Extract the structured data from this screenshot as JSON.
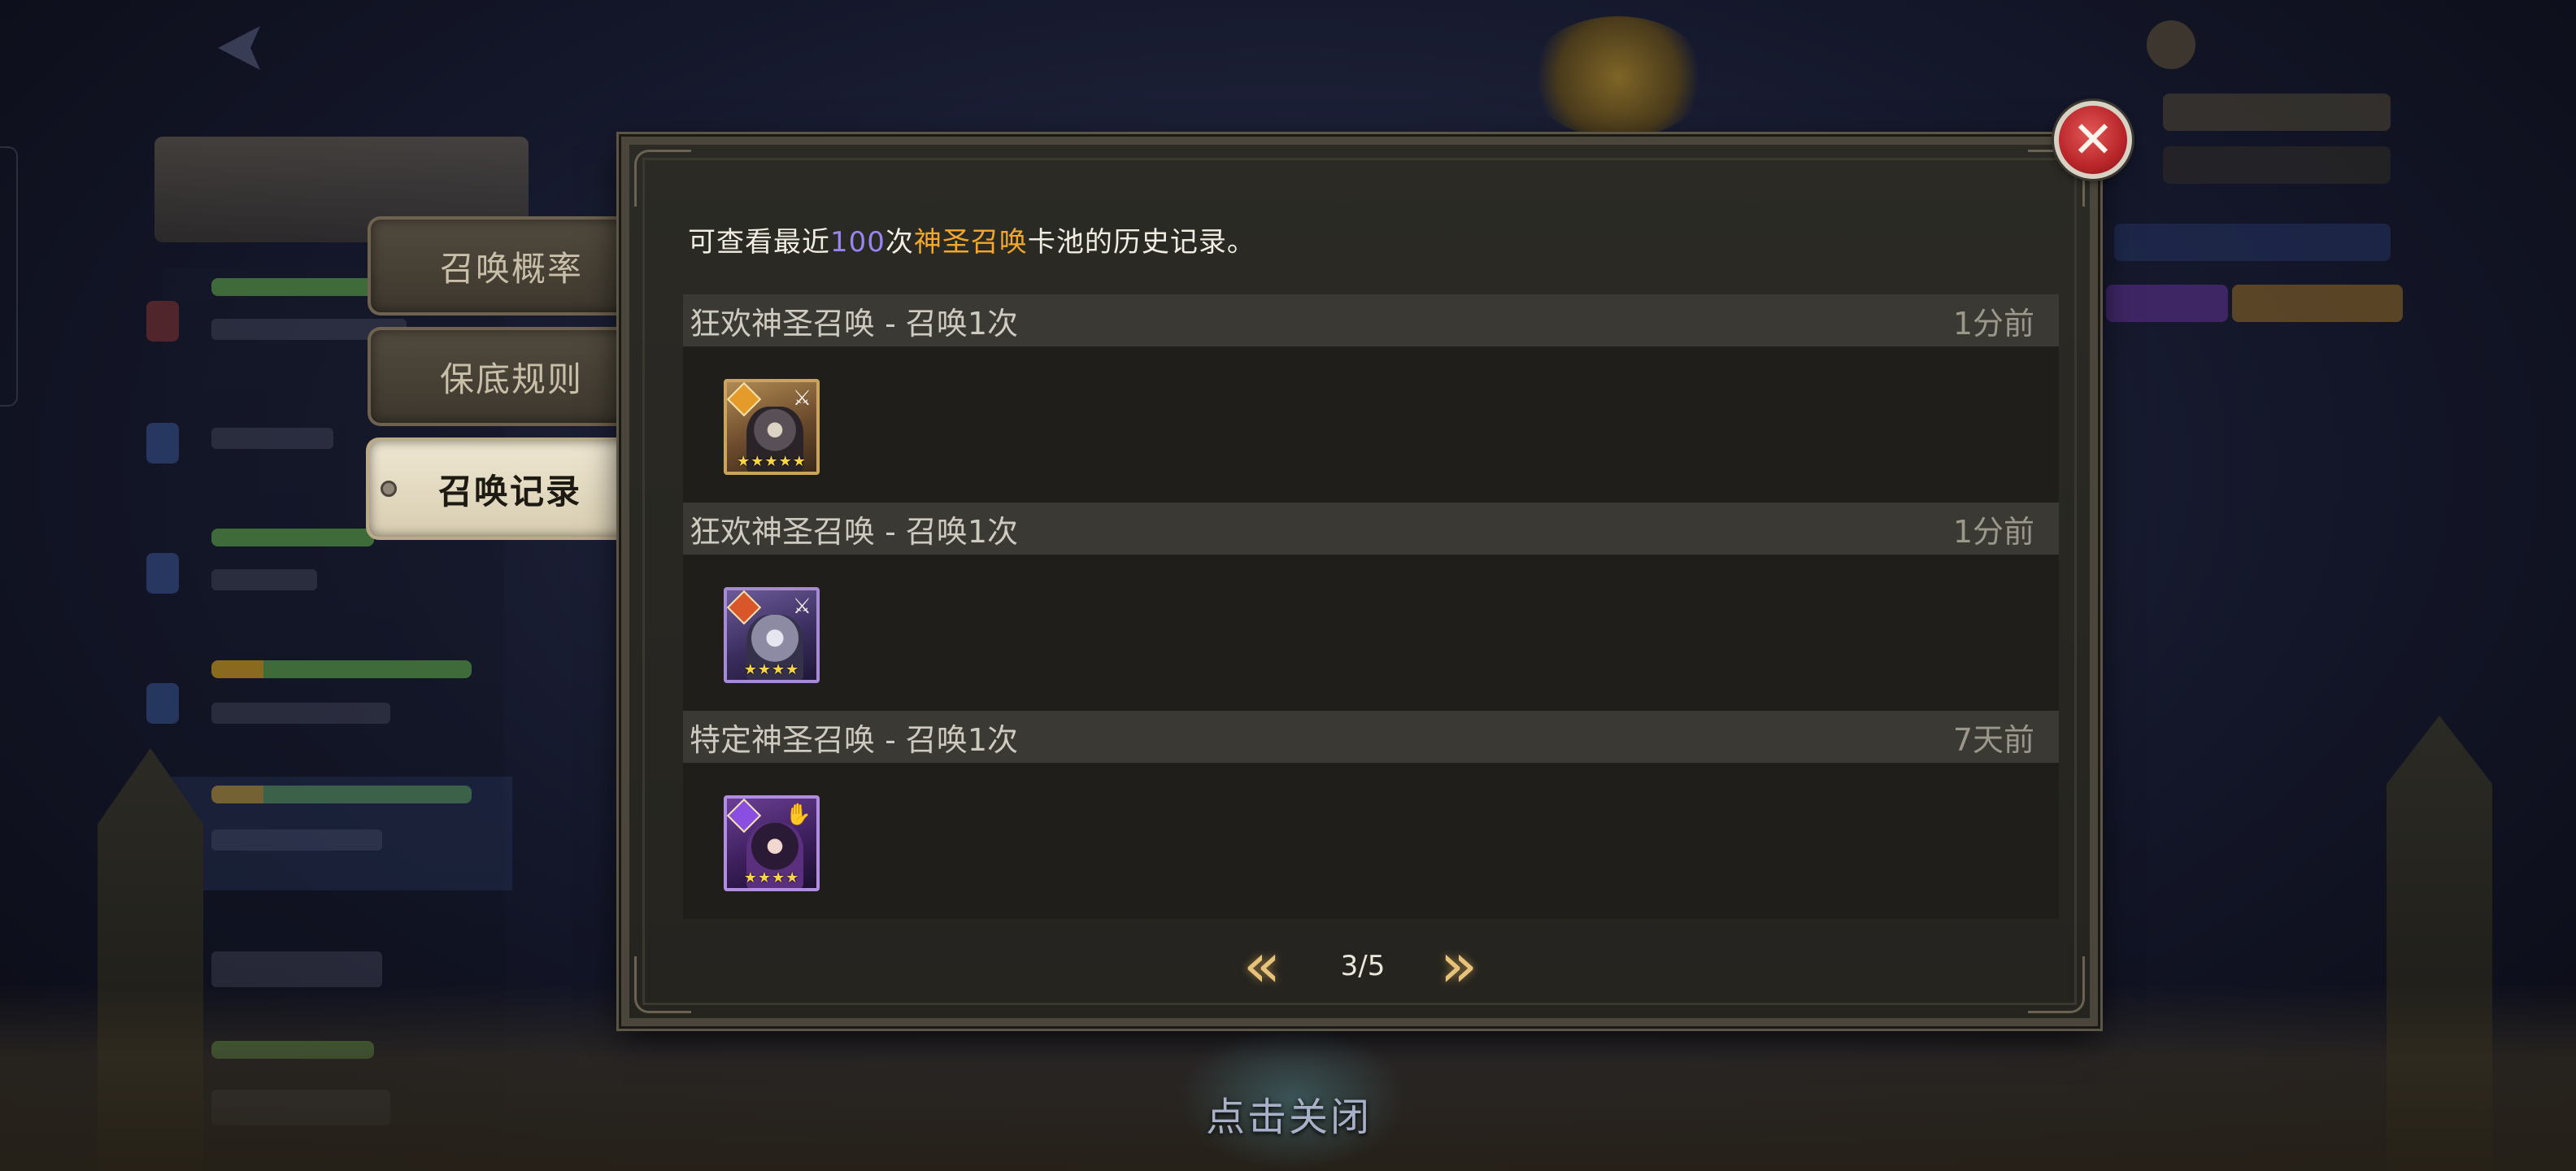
{
  "tabs": [
    {
      "label": "召唤概率",
      "active": false
    },
    {
      "label": "保底规则",
      "active": false
    },
    {
      "label": "召唤记录",
      "active": true
    }
  ],
  "dialog": {
    "info": {
      "prefix": "可查看最近",
      "count": "100",
      "middle": "次",
      "pool_name": "神圣召唤",
      "suffix": "卡池的历史记录。"
    },
    "records": [
      {
        "title": "狂欢神圣召唤 - 召唤1次",
        "time": "1分前",
        "hero_stars": "★★★★★",
        "hero_element": "fire-element-icon",
        "hero_class": "⚔"
      },
      {
        "title": "狂欢神圣召唤 - 召唤1次",
        "time": "1分前",
        "hero_stars": "★★★★",
        "hero_element": "flame-element-icon",
        "hero_class": "⚔"
      },
      {
        "title": "特定神圣召唤 - 召唤1次",
        "time": "7天前",
        "hero_stars": "★★★★",
        "hero_element": "dark-element-icon",
        "hero_class": "✋"
      }
    ],
    "pager": {
      "prev": "«",
      "next": "»",
      "label": "3/5"
    }
  },
  "close_icon": "✕",
  "tap_to_close": "点击关闭",
  "colors": {
    "highlight_count": "#9a84f0",
    "highlight_pool": "#f2a72e",
    "close_button": "#b9262a",
    "active_tab": "#efe7d2"
  }
}
